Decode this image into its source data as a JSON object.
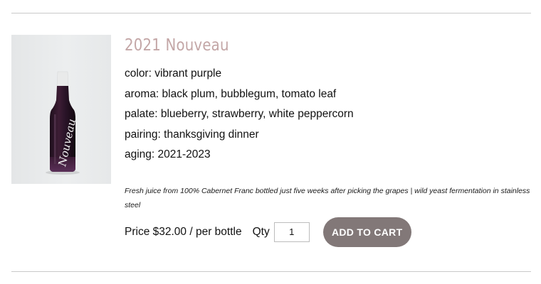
{
  "product": {
    "title": "2021 Nouveau",
    "attributes": [
      {
        "label": "color: vibrant purple"
      },
      {
        "label": "aroma: black plum, bubblegum, tomato leaf"
      },
      {
        "label": "palate: blueberry, strawberry, white peppercorn"
      },
      {
        "label": "pairing: thanksgiving dinner"
      },
      {
        "label": "aging: 2021-2023"
      }
    ],
    "description": "Fresh juice from 100% Cabernet Franc bottled just five weeks after picking the grapes | wild yeast fermentation in stainless steel",
    "price_text": "Price $32.00 / per bottle",
    "qty_label": "Qty",
    "qty_value": "1",
    "add_to_cart_label": "ADD TO CART",
    "bottle_label_text": "Nouveau"
  },
  "colors": {
    "title": "#c3a6a6",
    "button_bg": "#827878",
    "wine": "#3a1a30"
  }
}
